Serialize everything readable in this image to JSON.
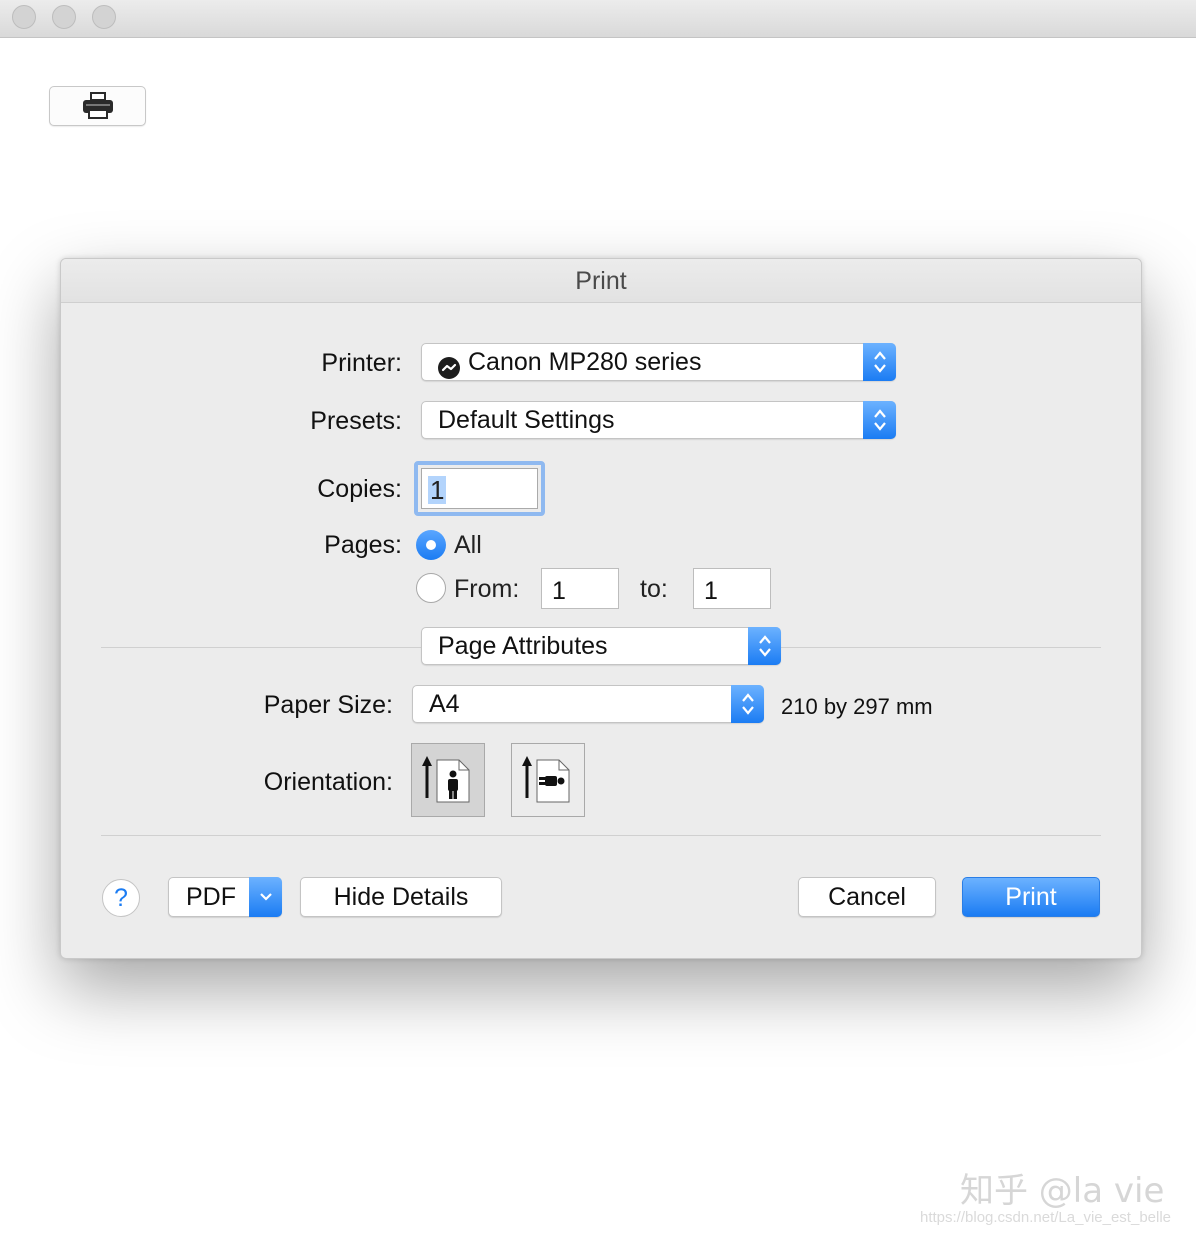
{
  "dialog": {
    "title": "Print",
    "printer": {
      "label": "Printer:",
      "value": "Canon MP280 series"
    },
    "presets": {
      "label": "Presets:",
      "value": "Default Settings"
    },
    "copies": {
      "label": "Copies:",
      "value": "1"
    },
    "pages": {
      "label": "Pages:",
      "all_label": "All",
      "from_label": "From:",
      "from_value": "1",
      "to_label": "to:",
      "to_value": "1",
      "selected": "All"
    },
    "section_menu": {
      "value": "Page Attributes"
    },
    "paper_size": {
      "label": "Paper Size:",
      "value": "A4",
      "dimensions": "210 by 297 mm"
    },
    "orientation": {
      "label": "Orientation:",
      "selected": "portrait"
    },
    "buttons": {
      "help": "?",
      "pdf": "PDF",
      "hide_details": "Hide Details",
      "cancel": "Cancel",
      "print": "Print"
    }
  },
  "watermark": {
    "text": "知乎 @la vie",
    "url": "https://blog.csdn.net/La_vie_est_belle"
  },
  "colors": {
    "accent": "#1b7cf3",
    "dialog_bg": "#ececec"
  },
  "icons": [
    "printer-icon",
    "printer-status-icon",
    "stepper-arrows-icon",
    "chevron-down-icon",
    "portrait-orientation-icon",
    "landscape-orientation-icon"
  ]
}
